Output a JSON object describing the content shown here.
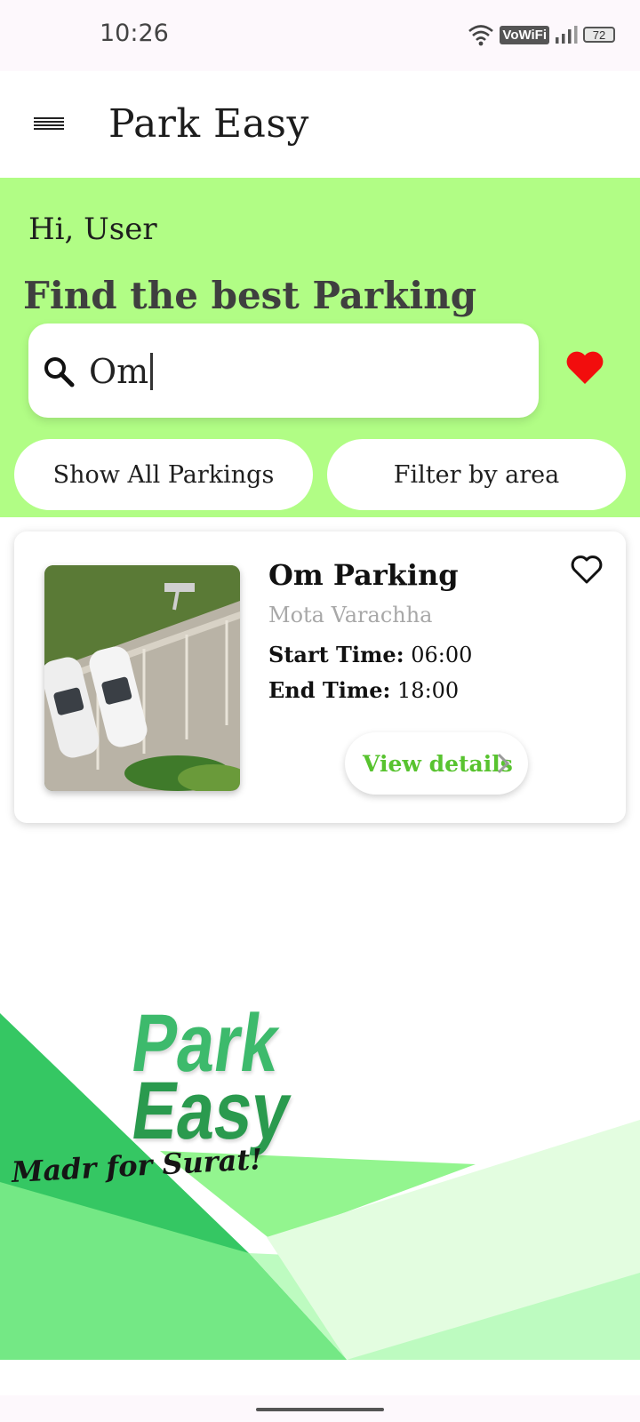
{
  "status_bar": {
    "time": "10:26",
    "vowifi_label": "VoWiFi",
    "battery_level": "72",
    "icons": [
      "wifi-icon",
      "signal-icon",
      "battery-icon"
    ]
  },
  "app_bar": {
    "title": "Park Easy",
    "menu_icon": "hamburger-menu-icon"
  },
  "hero": {
    "greeting": "Hi, User",
    "headline": "Find the best Parking",
    "search": {
      "value": "Om",
      "icon": "search-icon"
    },
    "favorites_icon": "heart-filled-icon",
    "show_all_label": "Show All Parkings",
    "filter_label": "Filter by area"
  },
  "results": [
    {
      "name": "Om Parking",
      "area": "Mota Varachha",
      "start_label": "Start Time:",
      "start_value": "06:00",
      "end_label": "End Time:",
      "end_value": "18:00",
      "view_details_label": "View details",
      "favorite_icon": "heart-outline-icon"
    }
  ],
  "branding": {
    "logo_line1": "Park",
    "logo_line2": "Easy",
    "tagline": "Madr for Surat!"
  },
  "colors": {
    "hero_bg": "#b1fd85",
    "accent_green": "#58c32f",
    "heart_red": "#f20d0d"
  }
}
